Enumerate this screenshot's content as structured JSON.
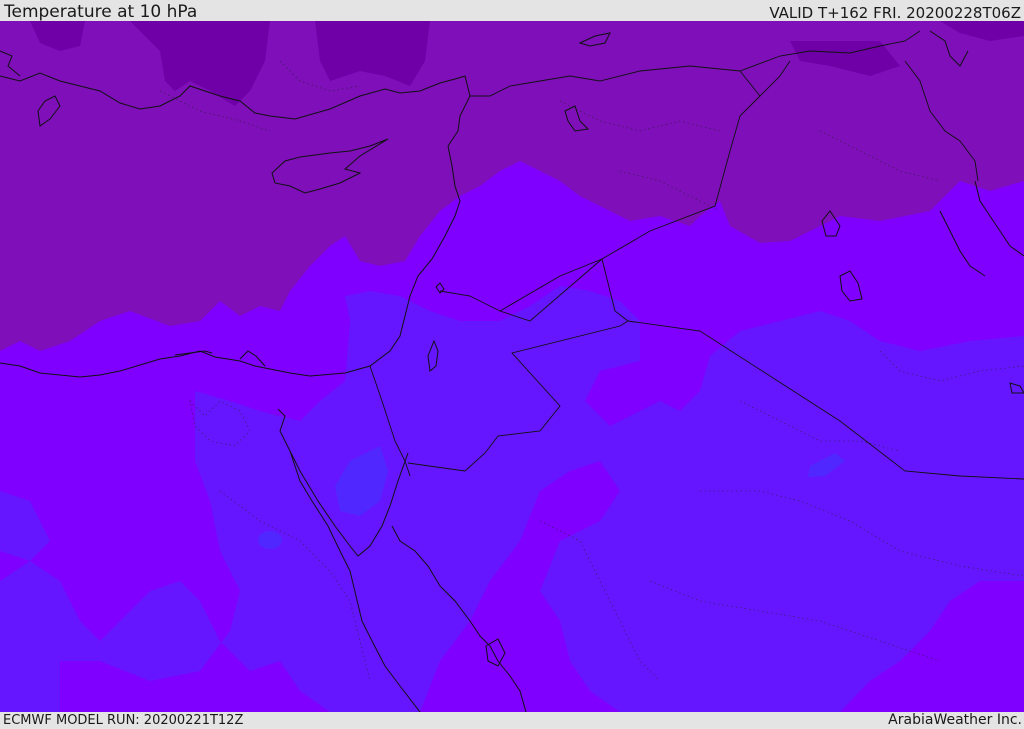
{
  "header": {
    "title": "Temperature at 10 hPa",
    "valid_time": "VALID T+162 FRI. 20200228T06Z"
  },
  "footer": {
    "model_run": "ECMWF MODEL RUN: 20200221T12Z",
    "credit": "ArabiaWeather Inc."
  },
  "map": {
    "field": "temperature",
    "pressure_level": "10 hPa",
    "colors": {
      "deep_purple": "#6f00a8",
      "purple": "#7e0fb9",
      "violet": "#8000ff",
      "blue_violet": "#6616ff",
      "light_blue_violet": "#5028ff",
      "coastline": "#111111"
    }
  }
}
